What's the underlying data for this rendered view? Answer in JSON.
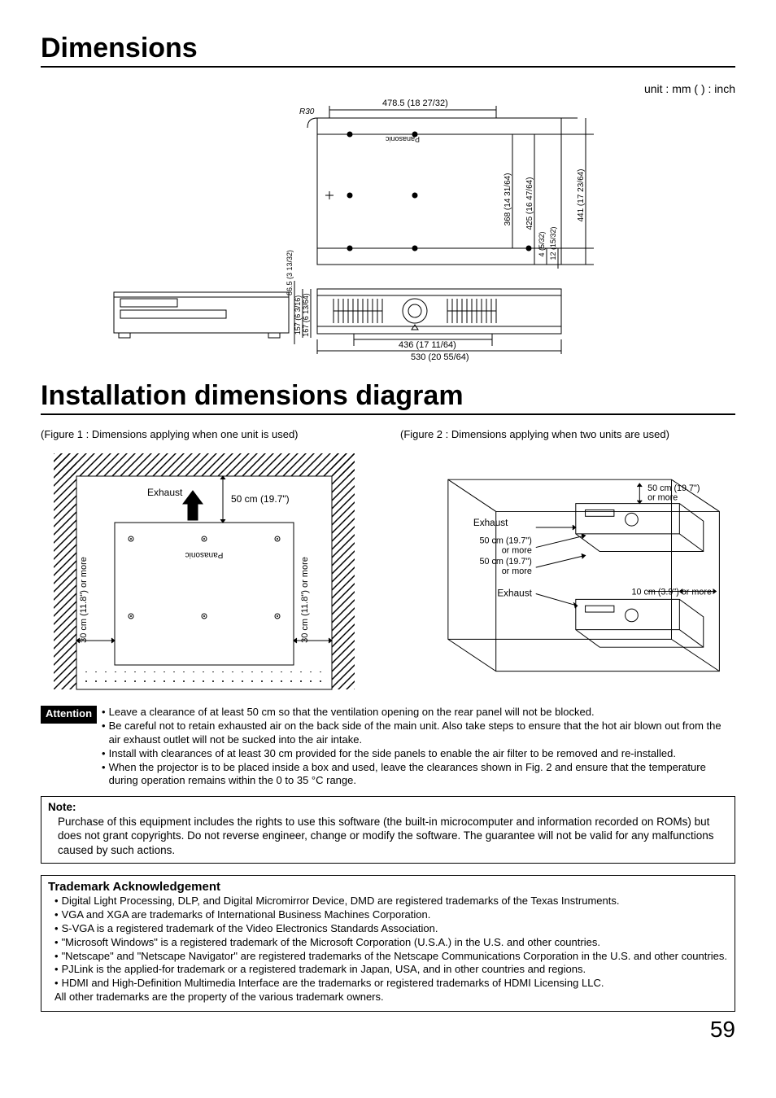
{
  "heading1": "Dimensions",
  "unit_note": "unit : mm ( ) : inch",
  "top_dims": {
    "r30": "R30",
    "top_width": "478.5 (18 27/32)",
    "h_368": "368 (14 31/64)",
    "h_425": "425 (16 47/64)",
    "h_441": "441 (17 23/64)",
    "off_4": "4 (5/32)",
    "off_12": "12 (15/32)",
    "bracket_h": "86.5 (3 13/32)",
    "side_157": "157 (6 3/16)",
    "side_167": "167 (6 13/64)",
    "front_436": "436 (17 11/64)",
    "total_530": "530 (20 55/64)",
    "brand": "Panasonic"
  },
  "heading2": "Installation dimensions diagram",
  "fig1_caption": "(Figure 1 : Dimensions applying when one unit is used)",
  "fig2_caption": "(Figure 2 : Dimensions applying when two units are used)",
  "fig1": {
    "exhaust": "Exhaust",
    "clear_top": "50 cm (19.7\")",
    "clear_side": "30 cm (11.8\") or more",
    "brand": "Panasonic"
  },
  "fig2": {
    "exhaust": "Exhaust",
    "c50_line1": "50 cm (19.7\")",
    "c50_line2": "or more",
    "c10": "10 cm (3.9\") or more"
  },
  "attention_label": "Attention",
  "attention": [
    "Leave a clearance of at least 50 cm so that the ventilation opening on the rear panel will not be blocked.",
    "Be careful not to retain exhausted air on the back side of the main unit. Also take steps to ensure that the hot air blown out from the air exhaust outlet will not be sucked into the air intake.",
    "Install with clearances of at least 30 cm provided for the side panels to enable the air filter to be removed and re-installed.",
    "When the projector is to be placed inside a box and used, leave the clearances shown in Fig. 2 and ensure that the temperature during operation remains within the 0 to 35 °C range."
  ],
  "note_title": "Note:",
  "note_body": "Purchase of this equipment includes the rights to use this software (the built-in microcomputer and information recorded on ROMs) but does not grant copyrights. Do not reverse engineer, change or modify the software. The guarantee will not be valid for any malfunctions caused by such actions.",
  "tm_title": "Trademark Acknowledgement",
  "tm_items": [
    "Digital Light Processing, DLP, and Digital Micromirror Device, DMD are registered trademarks of the Texas Instruments.",
    "VGA and XGA are trademarks of International Business Machines Corporation.",
    "S-VGA is a registered trademark of the Video Electronics Standards Association.",
    "\"Microsoft Windows\" is a registered trademark of the Microsoft Corporation (U.S.A.) in the U.S. and other countries.",
    "\"Netscape\" and \"Netscape Navigator\" are registered trademarks of the Netscape Communications Corporation in the U.S. and other countries.",
    "PJLink is the applied-for trademark or a registered trademark in Japan, USA, and in other countries and regions.",
    "HDMI and High-Definition Multimedia Interface are the trademarks or registered trademarks of HDMI Licensing LLC."
  ],
  "tm_footer": "All other trademarks are the property of the various trademark owners.",
  "page_number": "59"
}
